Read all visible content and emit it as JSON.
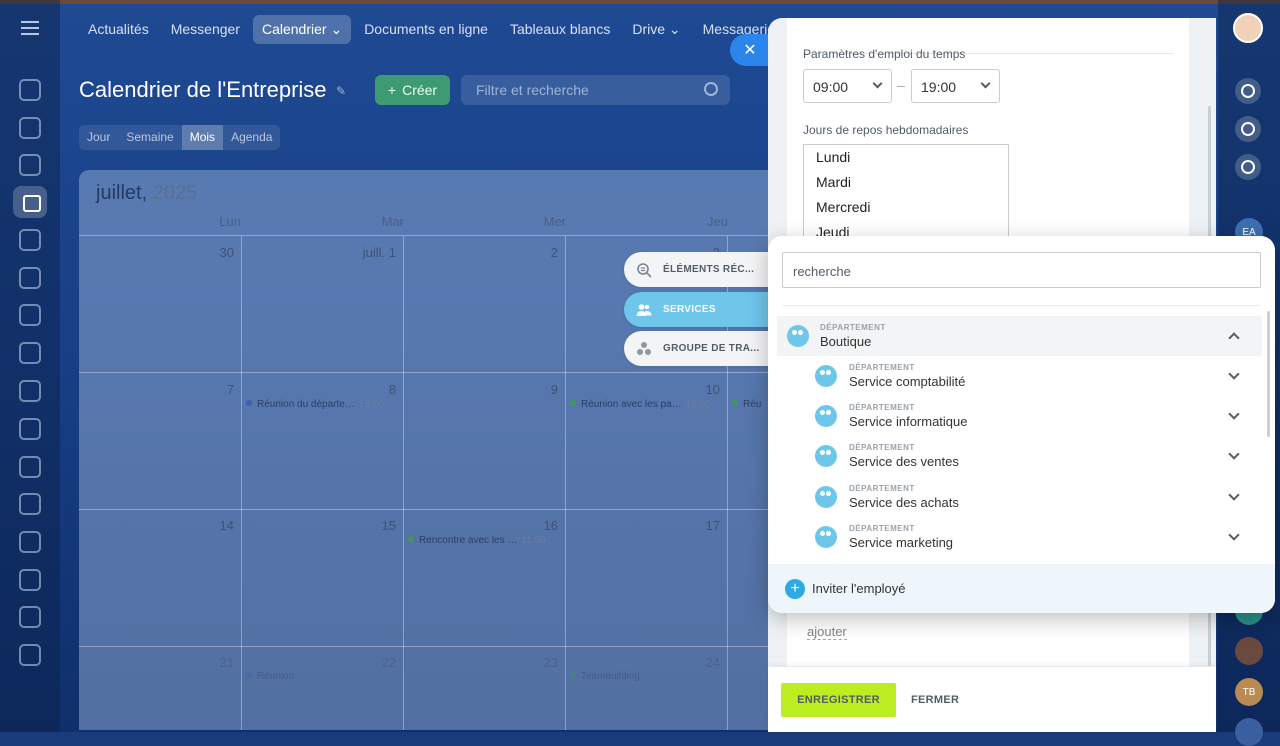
{
  "nav": {
    "items": [
      {
        "label": "Actualités",
        "active": false
      },
      {
        "label": "Messenger",
        "active": false
      },
      {
        "label": "Calendrier ⌄",
        "active": true
      },
      {
        "label": "Documents en ligne",
        "active": false
      },
      {
        "label": "Tableaux blancs",
        "active": false
      },
      {
        "label": "Drive ⌄",
        "active": false
      },
      {
        "label": "Messagerie",
        "active": false
      }
    ]
  },
  "page": {
    "title": "Calendrier de l'Entreprise",
    "create_label": "Créer",
    "search_placeholder": "Filtre et recherche",
    "views": [
      {
        "label": "Jour",
        "active": false
      },
      {
        "label": "Semaine",
        "active": false
      },
      {
        "label": "Mois",
        "active": true
      },
      {
        "label": "Agenda",
        "active": false
      }
    ]
  },
  "calendar": {
    "month": "juillet,",
    "year": "2025",
    "day_headers": [
      "Lun",
      "Mar",
      "Mer",
      "Jeu"
    ],
    "rows": [
      [
        "30",
        "juill. 1",
        "2",
        "3"
      ],
      [
        "7",
        "8",
        "9",
        "10"
      ],
      [
        "14",
        "15",
        "16",
        "17"
      ],
      [
        "21",
        "22",
        "23",
        "24"
      ]
    ],
    "events": [
      {
        "text": "Réunion du départe…",
        "time": "15:00",
        "color": "#3f5fb0"
      },
      {
        "text": "Réunion avec les pa…",
        "time": "10:00",
        "color": "#3e9a55"
      },
      {
        "text": "Réu",
        "time": "",
        "color": "#3e9a55"
      },
      {
        "text": "Rencontre avec les …",
        "time": "11:00",
        "color": "#3e9a55"
      },
      {
        "text": "Réunion",
        "time": "",
        "color": "#3f5fb0"
      },
      {
        "text": "Teambuilding",
        "time": "",
        "color": "#3e9a55"
      }
    ]
  },
  "slider": {
    "schedule_label": "Paramètres d'emploi du temps",
    "time_from": "09:00",
    "time_to": "19:00",
    "weekend_label": "Jours de repos hebdomadaires",
    "weekdays": [
      "Lundi",
      "Mardi",
      "Mercredi",
      "Jeudi"
    ],
    "add_label": "ajouter",
    "save_label": "ENREGISTRER",
    "close_label": "FERMER",
    "close_x": "✕"
  },
  "tabs": [
    {
      "label": "ÉLÉMENTS RÉC...",
      "icon": "search-list-icon",
      "active": false
    },
    {
      "label": "SERVICES",
      "icon": "users-icon",
      "active": true
    },
    {
      "label": "GROUPE DE TRA...",
      "icon": "group-icon",
      "active": false
    }
  ],
  "selector": {
    "search_placeholder": "recherche",
    "dept_caption": "DÉPARTEMENT",
    "root": "Boutique",
    "children": [
      "Service comptabilité",
      "Service informatique",
      "Service des ventes",
      "Service des achats",
      "Service marketing"
    ],
    "invite_label": "Inviter l'employé"
  },
  "right": {
    "avatars": [
      {
        "initials": "EA",
        "color": "#3d6fb0"
      },
      {
        "initials": "",
        "color": "#2a8f88"
      },
      {
        "initials": "",
        "color": "#6a4a3e"
      },
      {
        "initials": "TB",
        "color": "#b98a52"
      },
      {
        "initials": "",
        "color": "#3a5fa0"
      }
    ]
  },
  "colors": {
    "accent": "#2c85ea",
    "save": "#bbed21",
    "dept": "#6ec6ea"
  }
}
